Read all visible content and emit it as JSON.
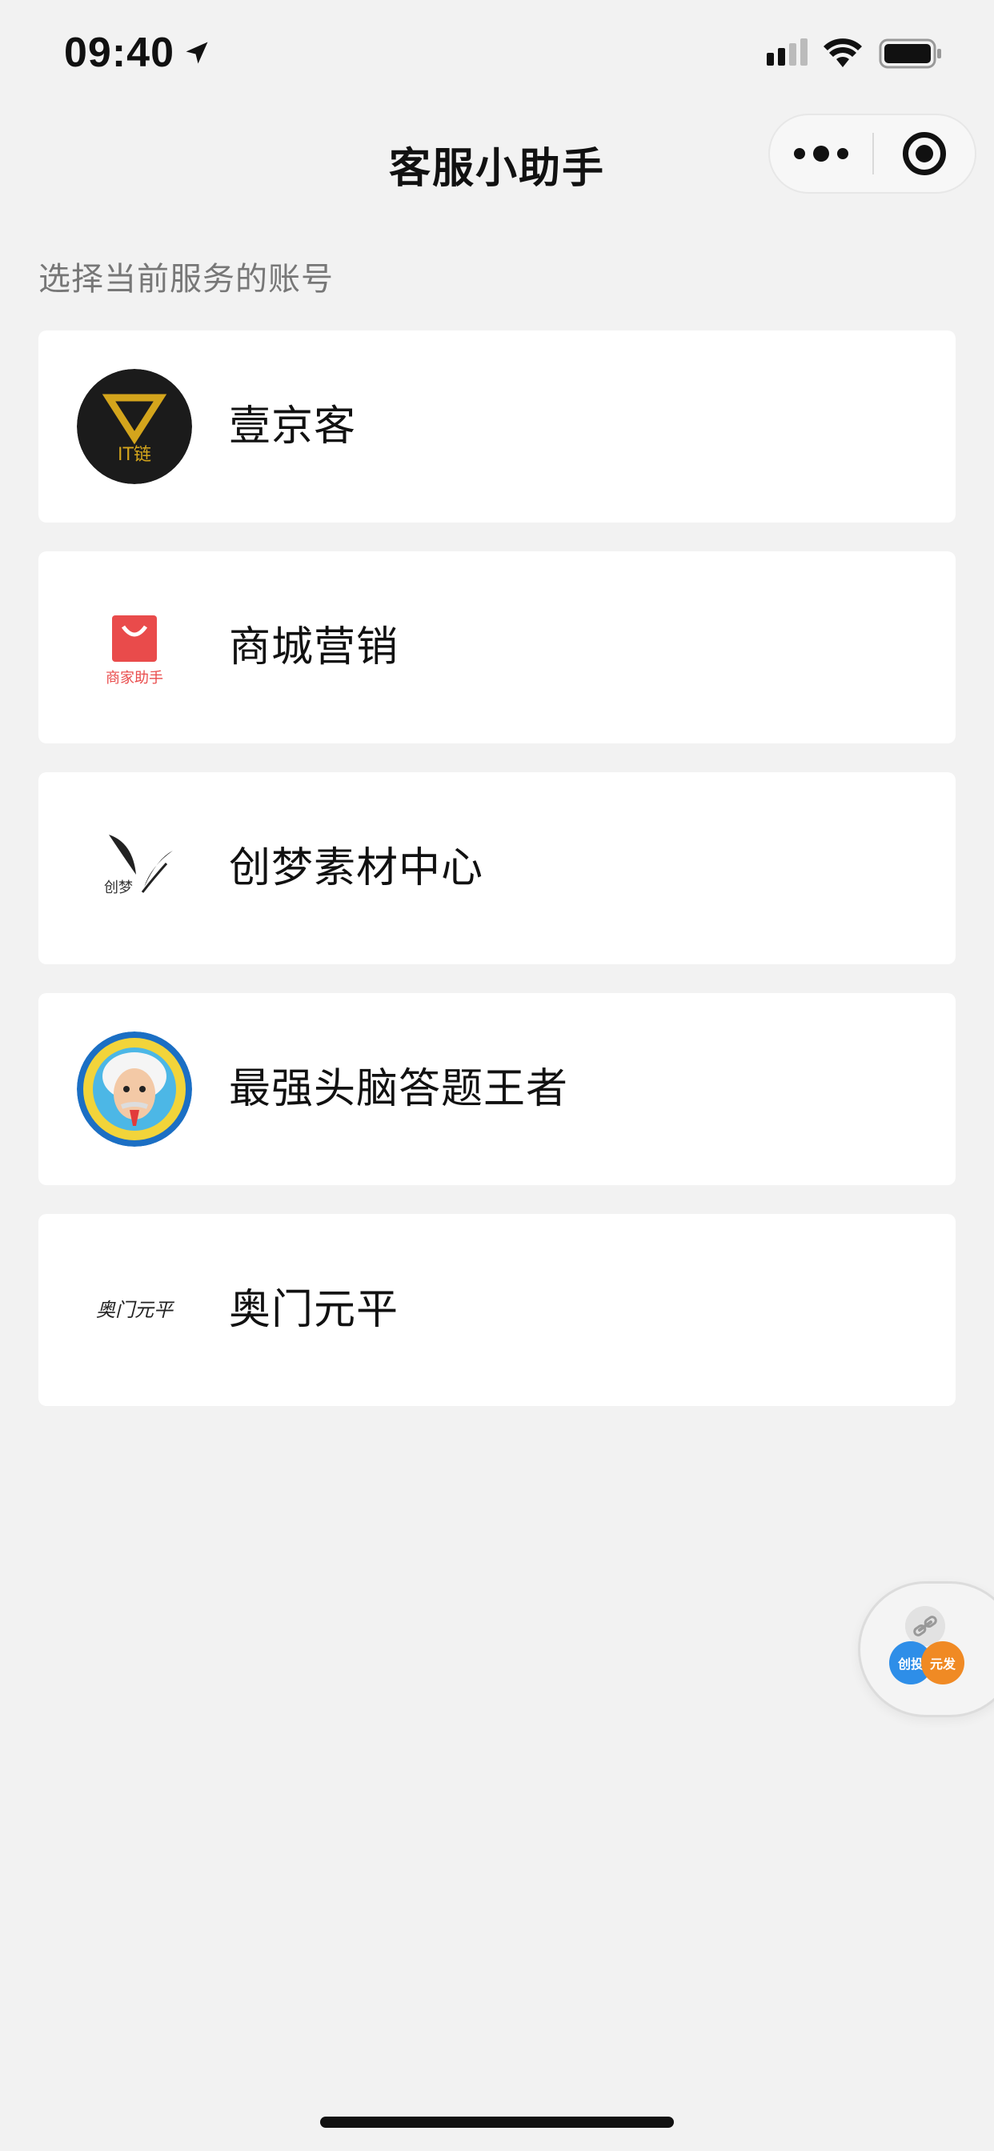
{
  "status_bar": {
    "time": "09:40",
    "icons": [
      "location-arrow-icon",
      "cellular-signal-icon",
      "wifi-icon",
      "battery-icon"
    ]
  },
  "nav": {
    "title": "客服小助手",
    "more_icon": "more-dots-icon",
    "close_icon": "target-close-icon"
  },
  "section_label": "选择当前服务的账号",
  "accounts": [
    {
      "name": "壹京客",
      "logo_text": "IT链"
    },
    {
      "name": "商城营销",
      "logo_text": "商家助手"
    },
    {
      "name": "创梦素材中心",
      "logo_text": "创梦"
    },
    {
      "name": "最强头脑答题王者",
      "logo_text": ""
    },
    {
      "name": "奥门元平",
      "logo_text": "奥门元平"
    }
  ],
  "floating_widget": {
    "icon": "link-icon",
    "left_badge": "创投",
    "right_badge": "元发"
  },
  "colors": {
    "background": "#f2f2f2",
    "card": "#ffffff",
    "label": "#777777",
    "mall_red": "#e94b4b",
    "gold": "#d4a51c",
    "widget_blue": "#2e8ee8",
    "widget_orange": "#f08a24"
  }
}
